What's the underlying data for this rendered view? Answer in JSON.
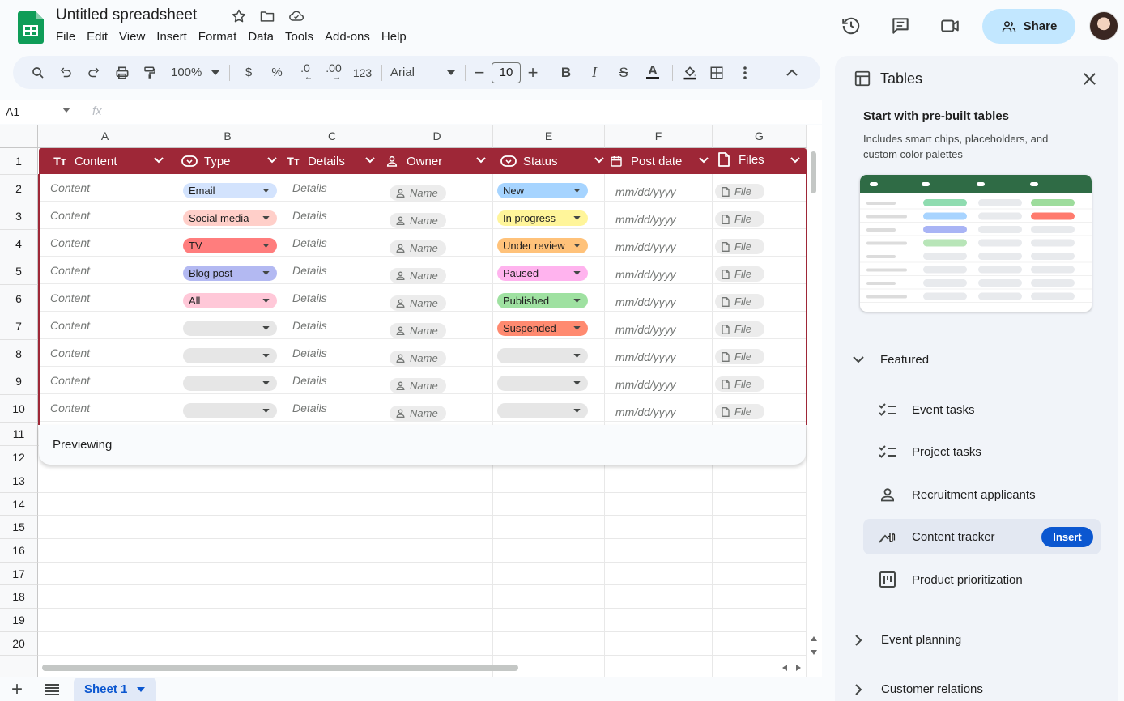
{
  "app": {
    "title": "Untitled spreadsheet",
    "menu": [
      "File",
      "Edit",
      "View",
      "Insert",
      "Format",
      "Data",
      "Tools",
      "Add-ons",
      "Help"
    ],
    "share_label": "Share"
  },
  "toolbar": {
    "zoom": "100%",
    "currency_symbol": "$",
    "percent_symbol": "%",
    "decrease_decimal": ".0",
    "increase_decimal": ".00",
    "number_format": "123",
    "font": "Arial",
    "font_size": "10"
  },
  "formula_bar": {
    "cell_ref": "A1",
    "fx": "fx"
  },
  "grid": {
    "columns": [
      "A",
      "B",
      "C",
      "D",
      "E",
      "F",
      "G"
    ],
    "rows": [
      "1",
      "2",
      "3",
      "4",
      "5",
      "6",
      "7",
      "8",
      "9",
      "10",
      "11",
      "12",
      "13",
      "14",
      "15",
      "16",
      "17",
      "18",
      "19",
      "20"
    ]
  },
  "table": {
    "header_color": "#9e2737",
    "headers": [
      "Content",
      "Type",
      "Details",
      "Owner",
      "Status",
      "Post date",
      "Files"
    ],
    "content_placeholder": "Content",
    "details_placeholder": "Details",
    "owner_placeholder": "Name",
    "date_placeholder": "mm/dd/yyyy",
    "file_placeholder": "File",
    "type_values": [
      {
        "label": "Email",
        "color": "#d3e3fd"
      },
      {
        "label": "Social media",
        "color": "#ffcfc9"
      },
      {
        "label": "TV",
        "color": "#ff7d7d"
      },
      {
        "label": "Blog post",
        "color": "#b3b9f2"
      },
      {
        "label": "All",
        "color": "#ffc8d8"
      },
      {
        "label": "",
        "color": "#e6e6e6"
      },
      {
        "label": "",
        "color": "#e6e6e6"
      },
      {
        "label": "",
        "color": "#e6e6e6"
      },
      {
        "label": "",
        "color": "#e6e6e6"
      }
    ],
    "status_values": [
      {
        "label": "New",
        "color": "#a6d4ff"
      },
      {
        "label": "In progress",
        "color": "#fff59a"
      },
      {
        "label": "Under review",
        "color": "#ffc27a"
      },
      {
        "label": "Paused",
        "color": "#ffb3ee"
      },
      {
        "label": "Published",
        "color": "#9fe1a1"
      },
      {
        "label": "Suspended",
        "color": "#ff8a70"
      },
      {
        "label": "",
        "color": "#e6e6e6"
      },
      {
        "label": "",
        "color": "#e6e6e6"
      },
      {
        "label": "",
        "color": "#e6e6e6"
      }
    ],
    "preview_label": "Previewing"
  },
  "sheets": {
    "active": "Sheet 1"
  },
  "side_panel": {
    "title": "Tables",
    "subtitle": "Start with pre-built tables",
    "description": "Includes smart chips, placeholders, and custom color palettes",
    "featured_label": "Featured",
    "items": [
      {
        "label": "Event tasks",
        "icon": "checklist-icon"
      },
      {
        "label": "Project tasks",
        "icon": "checklist-icon"
      },
      {
        "label": "Recruitment applicants",
        "icon": "person-icon"
      },
      {
        "label": "Content tracker",
        "icon": "content-icon",
        "hovered": true
      },
      {
        "label": "Product prioritization",
        "icon": "board-icon"
      }
    ],
    "insert_label": "Insert",
    "sections": [
      "Event planning",
      "Customer relations"
    ]
  },
  "colors": {
    "accent": "#0b57d0",
    "share_bg": "#c2e7ff",
    "sheets_green": "#0f9d58"
  }
}
